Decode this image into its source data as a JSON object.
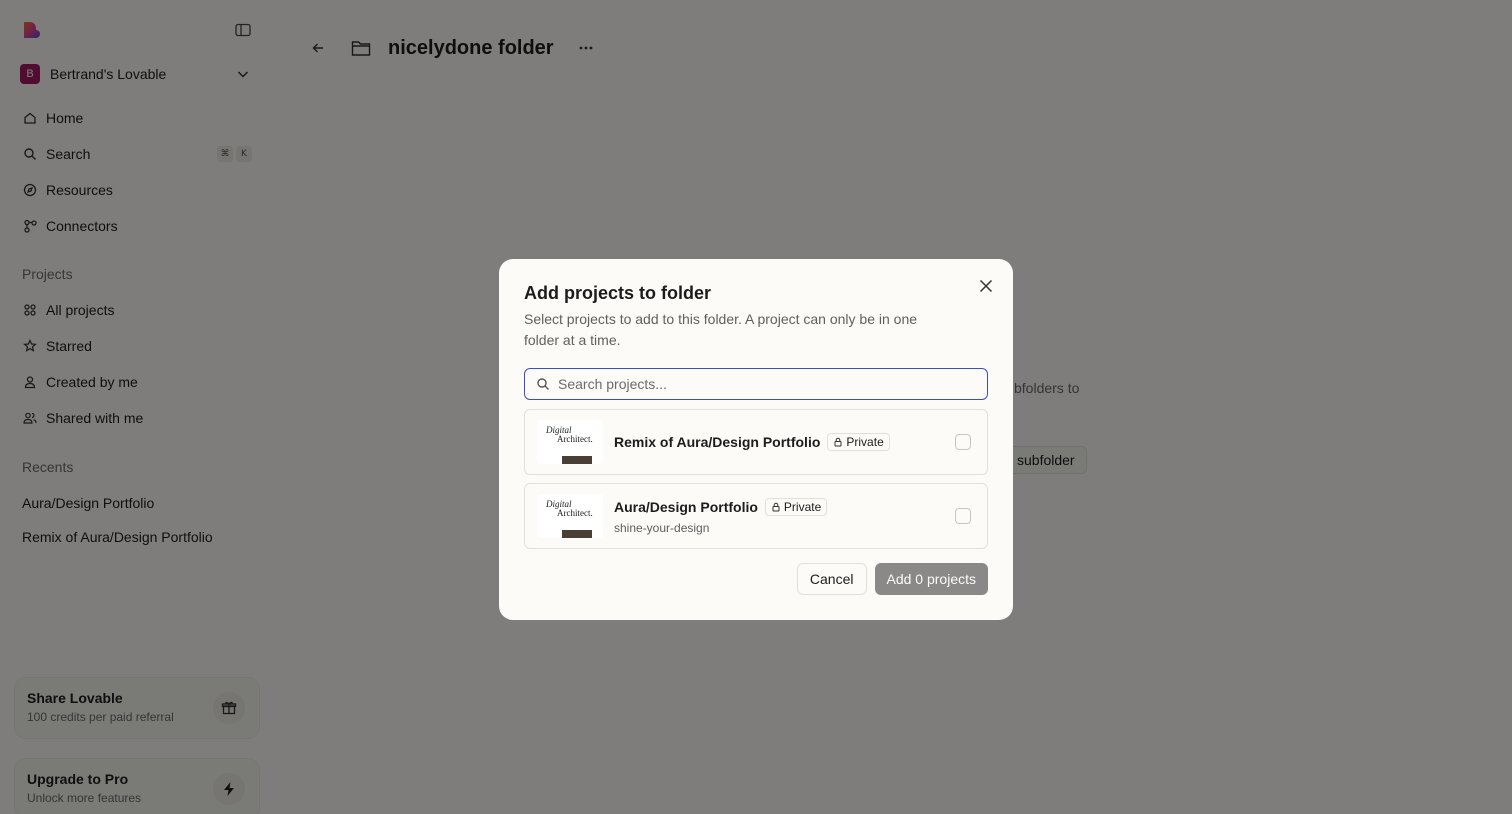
{
  "sidebar": {
    "workspace": {
      "initial": "B",
      "name": "Bertrand's Lovable"
    },
    "nav": [
      {
        "label": "Home",
        "icon": "home-icon"
      },
      {
        "label": "Search",
        "icon": "search-icon",
        "shortcut": [
          "⌘",
          "K"
        ]
      },
      {
        "label": "Resources",
        "icon": "compass-icon"
      },
      {
        "label": "Connectors",
        "icon": "connectors-icon"
      }
    ],
    "projects_label": "Projects",
    "projects": [
      {
        "label": "All projects",
        "icon": "grid-icon"
      },
      {
        "label": "Starred",
        "icon": "star-icon"
      },
      {
        "label": "Created by me",
        "icon": "user-icon"
      },
      {
        "label": "Shared with me",
        "icon": "users-icon"
      }
    ],
    "recents_label": "Recents",
    "recents": [
      "Aura/Design Portfolio",
      "Remix of Aura/Design Portfolio"
    ],
    "share_card": {
      "title": "Share Lovable",
      "subtitle": "100 credits per paid referral"
    },
    "upgrade_card": {
      "title": "Upgrade to Pro",
      "subtitle": "Unlock more features"
    }
  },
  "main": {
    "folder_title": "nicelydone folder",
    "bg_text": "bfolders to",
    "bg_button": "subfolder"
  },
  "modal": {
    "title": "Add projects to folder",
    "description": "Select projects to add to this folder. A project can only be in one folder at a time.",
    "search_placeholder": "Search projects...",
    "projects": [
      {
        "name": "Remix of Aura/Design Portfolio",
        "visibility": "Private",
        "slug": "",
        "thumb_line1": "Digital",
        "thumb_line2": "Architect."
      },
      {
        "name": "Aura/Design Portfolio",
        "visibility": "Private",
        "slug": "shine-your-design",
        "thumb_line1": "Digital",
        "thumb_line2": "Architect."
      }
    ],
    "cancel_label": "Cancel",
    "add_label": "Add 0 projects"
  },
  "colors": {
    "accent": "#3b4bd8",
    "workspace_avatar": "#a21a60",
    "disabled_button": "#8a8987"
  }
}
